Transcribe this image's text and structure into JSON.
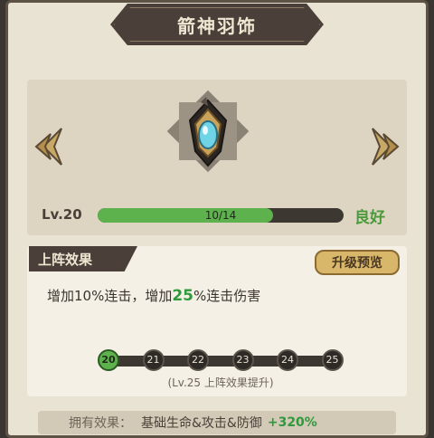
{
  "title": "箭神羽饰",
  "item": {
    "level_label": "Lv.20",
    "progress_text": "10/14",
    "progress_fraction": 0.714,
    "quality": "良好"
  },
  "effect": {
    "section_label": "上阵效果",
    "preview_button": "升级预览",
    "desc_prefix": "增加10%连击，增加",
    "desc_highlight": "25",
    "desc_suffix": "%连击伤害",
    "levels": [
      "20",
      "21",
      "22",
      "23",
      "24",
      "25"
    ],
    "active_level_index": 0,
    "hint": "(Lv.25 上阵效果提升)"
  },
  "owned": {
    "label": "拥有效果：",
    "text": "基础生命&攻击&防御",
    "value": "+320%"
  },
  "colors": {
    "accent_green": "#5eb24e",
    "panel_dark": "#4a4039"
  },
  "icons": [
    "arrow-left-icon",
    "arrow-right-icon",
    "gem-icon"
  ]
}
